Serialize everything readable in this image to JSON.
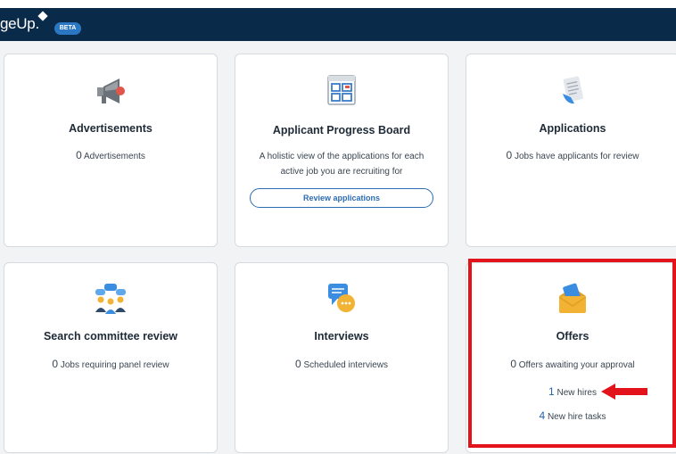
{
  "header": {
    "logo_text": "geUp.",
    "badge": "BETA"
  },
  "colors": {
    "header_bg": "#0a2a4a",
    "link": "#2463b0",
    "highlight": "#e3131c"
  },
  "cards": {
    "advertisements": {
      "icon": "megaphone-icon",
      "title": "Advertisements",
      "count": "0",
      "desc": "Advertisements"
    },
    "progress_board": {
      "icon": "board-icon",
      "title": "Applicant Progress Board",
      "desc_line1": "A holistic view of the applications for each",
      "desc_line2": "active job you are recruiting for",
      "button": "Review applications"
    },
    "applications": {
      "icon": "document-icon",
      "title": "Applications",
      "count": "0",
      "desc": "Jobs have applicants for review"
    },
    "search_committee": {
      "icon": "committee-icon",
      "title": "Search committee review",
      "count": "0",
      "desc": "Jobs requiring panel review"
    },
    "interviews": {
      "icon": "chat-icon",
      "title": "Interviews",
      "count": "0",
      "desc": "Scheduled interviews"
    },
    "offers": {
      "icon": "envelope-icon",
      "title": "Offers",
      "count": "0",
      "desc": "Offers awaiting your approval",
      "new_hires_count": "1",
      "new_hires_label": "New hires",
      "tasks_count": "4",
      "tasks_label": "New hire tasks"
    }
  }
}
